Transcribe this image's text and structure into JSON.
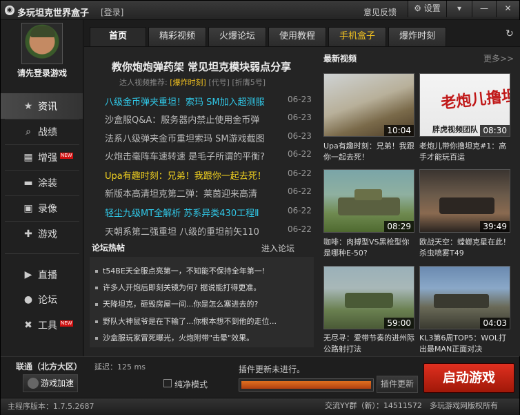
{
  "titlebar": {
    "title": "多玩坦克世界盒子",
    "login": "[登录]",
    "feedback": "意见反馈",
    "settings": "设置",
    "menu_icon": "menu-icon",
    "minimize_icon": "minimize-icon",
    "close_icon": "close-icon"
  },
  "sidebar": {
    "login_prompt": "请先登录游戏",
    "items": [
      {
        "label": "资讯",
        "icon": "star-icon",
        "active": true
      },
      {
        "label": "战绩",
        "icon": "search-icon"
      },
      {
        "label": "增强",
        "icon": "toolbox-icon",
        "badge": "NEW"
      },
      {
        "label": "涂装",
        "icon": "tank-icon"
      },
      {
        "label": "录像",
        "icon": "film-icon"
      },
      {
        "label": "游戏",
        "icon": "gamepad-icon"
      },
      {
        "label": "直播",
        "icon": "play-icon"
      },
      {
        "label": "论坛",
        "icon": "chat-icon"
      },
      {
        "label": "工具",
        "icon": "tools-icon",
        "badge": "NEW"
      }
    ]
  },
  "tabs": [
    {
      "label": "首页",
      "active": true
    },
    {
      "label": "精彩视频"
    },
    {
      "label": "火爆论坛"
    },
    {
      "label": "使用教程"
    },
    {
      "label": "手机盒子",
      "highlight": true
    },
    {
      "label": "爆炸时刻"
    }
  ],
  "main": {
    "headline": "教你炮炮弹药架 常见坦克模块弱点分享",
    "recommend_prefix": "达人视频推荐:",
    "recommend_link": "[爆炸时刻]",
    "recommend_code": "[代号]",
    "recommend_fold": "[折膺5号]",
    "news": [
      {
        "title": "八级金币弹夹重坦！索玛 SM加入超测服",
        "date": "06-23",
        "color": "cyan"
      },
      {
        "title": "沙盒服Q&A：服务器内禁止使用金币弹",
        "date": "06-23",
        "color": "gray"
      },
      {
        "title": "法系八级弹夹金币重坦索玛 SM游戏截图",
        "date": "06-23",
        "color": "gray"
      },
      {
        "title": "火炮击毫阵车速转速 是毛子所谓的平衡?",
        "date": "06-22",
        "color": "gray"
      },
      {
        "title": "Upa有趣时刻：兄弟！我跟你一起去死！",
        "date": "06-22",
        "color": "yellow"
      },
      {
        "title": "新版本高清坦克第二弹：莱茵迎来高清",
        "date": "06-22",
        "color": "gray"
      },
      {
        "title": "轻尘九级MT全解析 苏系异类430工程Ⅱ",
        "date": "06-22",
        "color": "cyan"
      },
      {
        "title": "天朝系第二强重坦 八级的重坦前矢110",
        "date": "06-22",
        "color": "gray"
      }
    ],
    "forum_title": "论坛热帖",
    "forum_more": "进入论坛",
    "forum": [
      "t54BE天全服点亮第一，不知能不保持全年第一!",
      "许多人开炮后即刻关镜为何? 据说能打得更准。",
      "天降坦克，砸毁房屋一间...你是怎么塞进去的?",
      "野队大神鼠爷是在下输了...你根本想不到他的走位...",
      "沙盒服玩家冒死曝光，火炮附带\"击晕\"效果。"
    ]
  },
  "videos": {
    "title": "最新视频",
    "more": "更多>>",
    "items": [
      {
        "duration": "10:04",
        "caption": "Upa有趣时刻：兄弟！我跟你一起去死！",
        "bg": "linear-gradient(160deg,#cfd3d4 0%,#b8b09a 45%,#7a6a4a 70%,#4a3a26 100%)"
      },
      {
        "duration": "08:30",
        "caption": "老炮儿带你撸坦克#1：高手才能玩百运",
        "bg": "linear-gradient(180deg,#f4f4f4 0%,#e8e8e8 100%)",
        "overlay": "老炮儿撸坦克",
        "sub": "胖虎视频团队"
      },
      {
        "duration": "08:29",
        "caption": "咖啡：肉搏型VS黑枪型你是哪种E-50?",
        "bg": "linear-gradient(180deg,#7aa5a8 0%,#8fb0a0 40%,#6f8a50 70%,#4f6a30 100%)"
      },
      {
        "duration": "39:49",
        "caption": "欧战天空：螳螂克星在此！杀虫喷雾T49",
        "bg": "linear-gradient(180deg,#3a3430 0%,#6a5a4a 40%,#8a6a50 70%,#2a2420 100%)"
      },
      {
        "duration": "59:00",
        "caption": "无尽寻：爱带节奏的进州际公路射打法",
        "bg": "linear-gradient(180deg,#9ab0b8 0%,#a8b8b8 35%,#6a8050 70%,#4a5a36 100%)"
      },
      {
        "duration": "04:03",
        "caption": "KL3第6周TOP5：WOL打出最MAN正面对决",
        "bg": "linear-gradient(180deg,#6a8ab0 0%,#8aa8c8 35%,#6a6a58 65%,#3a3a30 100%)"
      }
    ]
  },
  "bottom": {
    "server": "联通（北方大区）",
    "latency": "延迟：125 ms",
    "accelerate": "游戏加速",
    "pure_mode": "纯净模式",
    "plugin_status": "插件更新未进行。",
    "progress": 1.0,
    "plugin_update": "插件更新",
    "launch": "启动游戏"
  },
  "statusbar": {
    "version": "主程序版本：1.7.5.2687",
    "qq_group": "交流YY群（新）：14511572",
    "copyright": "多玩游戏网版权所有"
  }
}
